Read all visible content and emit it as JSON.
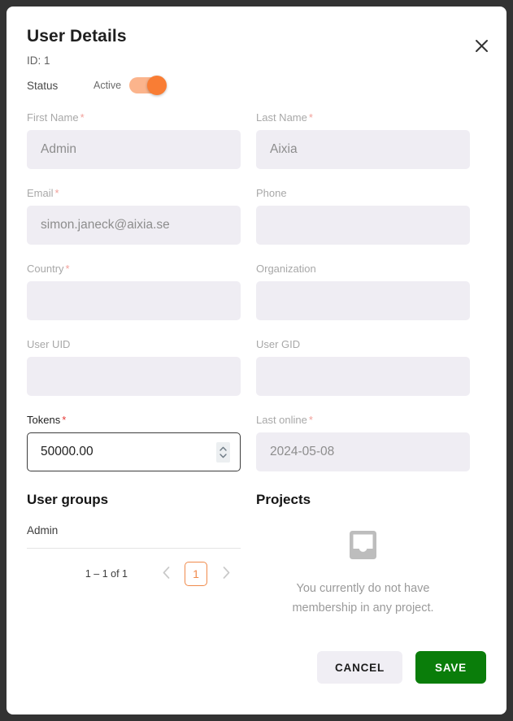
{
  "dialog": {
    "title": "User Details",
    "id_line": "ID: 1",
    "close_icon": "close-icon"
  },
  "status": {
    "label": "Status",
    "value": "Active",
    "toggle_on": true,
    "accent": "#f97d34",
    "track": "#fbb48c"
  },
  "fields": [
    {
      "label": "First Name",
      "required": true,
      "value": "Admin",
      "disabled": true
    },
    {
      "label": "Last Name",
      "required": true,
      "value": "Aixia",
      "disabled": true
    },
    {
      "label": "Email",
      "required": true,
      "value": "simon.janeck@aixia.se",
      "disabled": true
    },
    {
      "label": "Phone",
      "required": false,
      "value": "",
      "disabled": true
    },
    {
      "label": "Country",
      "required": true,
      "value": "",
      "disabled": true
    },
    {
      "label": "Organization",
      "required": false,
      "value": "",
      "disabled": true
    },
    {
      "label": "User UID",
      "required": false,
      "value": "",
      "disabled": true
    },
    {
      "label": "User GID",
      "required": false,
      "value": "",
      "disabled": true
    },
    {
      "label": "Tokens",
      "required": true,
      "value": "50000.00",
      "disabled": false
    },
    {
      "label": "Last online",
      "required": true,
      "value": "2024-05-08",
      "disabled": true
    }
  ],
  "required_marker": "*",
  "user_groups": {
    "title": "User groups",
    "rows": [
      "Admin"
    ],
    "paginator": {
      "range_label": "1 – 1 of 1",
      "prev_icon": "chevron-left-icon",
      "next_icon": "chevron-right-icon",
      "current_page": "1"
    }
  },
  "projects": {
    "title": "Projects",
    "empty_icon": "inbox-icon",
    "empty_message": "You currently do not have membership in any project."
  },
  "footer": {
    "cancel_label": "CANCEL",
    "save_label": "SAVE",
    "save_color": "#0a7d0a"
  }
}
